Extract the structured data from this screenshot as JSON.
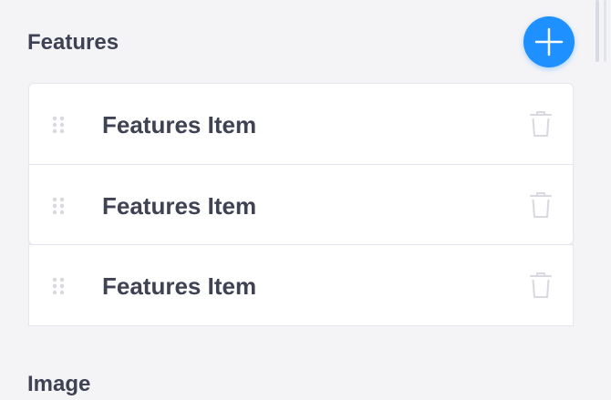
{
  "features_section": {
    "title": "Features",
    "add_icon": "plus-icon",
    "items": [
      {
        "label": "Features Item",
        "handle_icon": "drag-handle-icon",
        "delete_icon": "trash-icon"
      },
      {
        "label": "Features Item",
        "handle_icon": "drag-handle-icon",
        "delete_icon": "trash-icon"
      },
      {
        "label": "Features Item",
        "handle_icon": "drag-handle-icon",
        "delete_icon": "trash-icon"
      }
    ]
  },
  "image_section": {
    "title": "Image"
  },
  "colors": {
    "accent": "#1e90ff",
    "text": "#3e4253",
    "muted_icon": "#d7d8e0",
    "background": "#f4f4f7",
    "card": "#ffffff"
  }
}
